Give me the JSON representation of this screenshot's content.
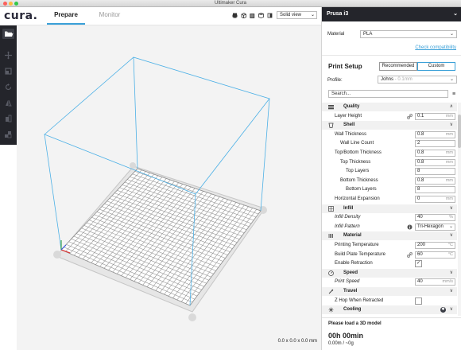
{
  "window": {
    "title": "Ultimaker Cura"
  },
  "logo": "cura.",
  "tabs": [
    {
      "label": "Prepare"
    },
    {
      "label": "Monitor"
    }
  ],
  "view_mode": "Solid view",
  "dimensions": "0.0 x 0.0 x 0.0 mm",
  "printer": {
    "name": "Prusa i3"
  },
  "material": {
    "label": "Material",
    "value": "PLA",
    "compat_link": "Check compatibility"
  },
  "print_setup": {
    "title": "Print Setup",
    "modes": [
      {
        "label": "Recommended",
        "active": false
      },
      {
        "label": "Custom",
        "active": true
      }
    ],
    "profile_label": "Profile:",
    "profile_value": "Johns",
    "profile_hint": "- 0.1mm",
    "search_placeholder": "Search..."
  },
  "settings": [
    {
      "kind": "category",
      "label": "Quality",
      "icon": "quality-icon",
      "chevron": "∧"
    },
    {
      "kind": "setting",
      "label": "Layer Height",
      "indent": 0,
      "value": "0.1",
      "unit": "mm",
      "link": true
    },
    {
      "kind": "category",
      "label": "Shell",
      "icon": "shell-icon",
      "chevron": "∨"
    },
    {
      "kind": "setting",
      "label": "Wall Thickness",
      "indent": 0,
      "value": "0.8",
      "unit": "mm"
    },
    {
      "kind": "setting",
      "label": "Wall Line Count",
      "indent": 1,
      "value": "2",
      "unit": ""
    },
    {
      "kind": "setting",
      "label": "Top/Bottom Thickness",
      "indent": 0,
      "value": "0.8",
      "unit": "mm"
    },
    {
      "kind": "setting",
      "label": "Top Thickness",
      "indent": 1,
      "value": "0.8",
      "unit": "mm"
    },
    {
      "kind": "setting",
      "label": "Top Layers",
      "indent": 2,
      "value": "8",
      "unit": ""
    },
    {
      "kind": "setting",
      "label": "Bottom Thickness",
      "indent": 1,
      "value": "0.8",
      "unit": "mm"
    },
    {
      "kind": "setting",
      "label": "Bottom Layers",
      "indent": 2,
      "value": "8",
      "unit": ""
    },
    {
      "kind": "setting",
      "label": "Horizontal Expansion",
      "indent": 0,
      "value": "0",
      "unit": "mm"
    },
    {
      "kind": "category",
      "label": "Infill",
      "icon": "infill-icon",
      "chevron": "∨"
    },
    {
      "kind": "setting",
      "label": "Infill Density",
      "indent": 0,
      "value": "40",
      "unit": "%",
      "italic": true
    },
    {
      "kind": "setting",
      "label": "Infill Pattern",
      "indent": 0,
      "value": "Tri-Hexagon",
      "unit": "",
      "italic": true,
      "dropdown": true,
      "info": true
    },
    {
      "kind": "category",
      "label": "Material",
      "icon": "material-icon",
      "chevron": "∨"
    },
    {
      "kind": "setting",
      "label": "Printing Temperature",
      "indent": 0,
      "value": "200",
      "unit": "°C"
    },
    {
      "kind": "setting",
      "label": "Build Plate Temperature",
      "indent": 0,
      "value": "60",
      "unit": "°C",
      "link": true
    },
    {
      "kind": "setting",
      "label": "Enable Retraction",
      "indent": 0,
      "checkbox": true,
      "checked": true
    },
    {
      "kind": "category",
      "label": "Speed",
      "icon": "speed-icon",
      "chevron": "∨"
    },
    {
      "kind": "setting",
      "label": "Print Speed",
      "indent": 0,
      "value": "40",
      "unit": "mm/s",
      "italic": true
    },
    {
      "kind": "category",
      "label": "Travel",
      "icon": "travel-icon",
      "chevron": "∨"
    },
    {
      "kind": "setting",
      "label": "Z Hop When Retracted",
      "indent": 0,
      "checkbox": true,
      "checked": false
    },
    {
      "kind": "category",
      "label": "Cooling",
      "icon": "cooling-icon",
      "chevron": "∨",
      "badge": true
    }
  ],
  "summary": {
    "message": "Please load a 3D model",
    "time": "00h 00min",
    "material_usage": "0.00m / ~0g"
  },
  "colors": {
    "accent": "#3aa0d8",
    "dark": "#24252b",
    "viewport": "#f3f3f3",
    "volume_lines": "#4cb0e6"
  }
}
